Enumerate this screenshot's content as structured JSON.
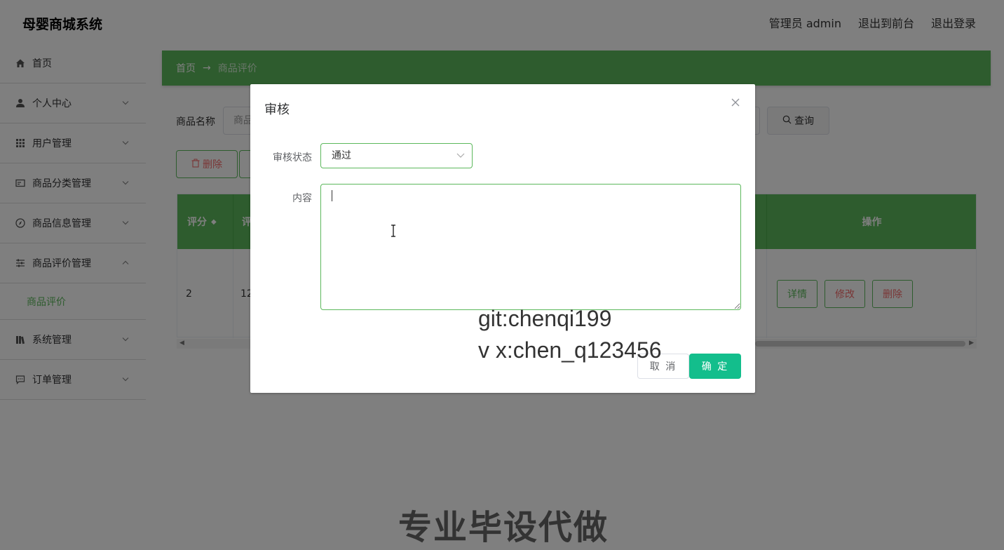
{
  "header": {
    "app_title": "母婴商城系统",
    "user_label": "管理员 admin",
    "to_frontend": "退出到前台",
    "logout": "退出登录"
  },
  "sidebar": {
    "items": [
      {
        "label": "首页",
        "icon": "home-icon",
        "has_chevron": false
      },
      {
        "label": "个人中心",
        "icon": "user-icon",
        "has_chevron": true
      },
      {
        "label": "用户管理",
        "icon": "grid-icon",
        "has_chevron": true
      },
      {
        "label": "商品分类管理",
        "icon": "card-icon",
        "has_chevron": true
      },
      {
        "label": "商品信息管理",
        "icon": "compass-icon",
        "has_chevron": true
      },
      {
        "label": "商品评价管理",
        "icon": "sliders-icon",
        "has_chevron": true,
        "expanded": true
      },
      {
        "label": "系统管理",
        "icon": "books-icon",
        "has_chevron": true
      },
      {
        "label": "订单管理",
        "icon": "chat-icon",
        "has_chevron": true
      }
    ],
    "active_sub_item": "商品评价"
  },
  "breadcrumb": {
    "home": "首页",
    "arrow": "→",
    "current": "商品评价"
  },
  "search": {
    "label": "商品名称",
    "placeholder": "商品",
    "query_button": "查询"
  },
  "toolbar": {
    "delete_label": "删除"
  },
  "table": {
    "headers": {
      "score": "评分",
      "col2": "评",
      "ops": "操作"
    },
    "rows": [
      {
        "score": "2",
        "col2": "12"
      }
    ],
    "row_actions": {
      "detail": "详情",
      "edit": "修改",
      "delete": "删除"
    }
  },
  "dialog": {
    "title": "审核",
    "status_label": "审核状态",
    "status_value": "通过",
    "content_label": "内容",
    "content_value": "",
    "cancel": "取 消",
    "confirm": "确 定"
  },
  "watermarks": {
    "line1": "git:chenqi199",
    "line2": "v x:chen_q123456",
    "line3": "专业毕设代做"
  },
  "colors": {
    "primary_green": "#5cb85c",
    "confirm_teal": "#13be8c",
    "danger_red": "#f56c6c"
  }
}
